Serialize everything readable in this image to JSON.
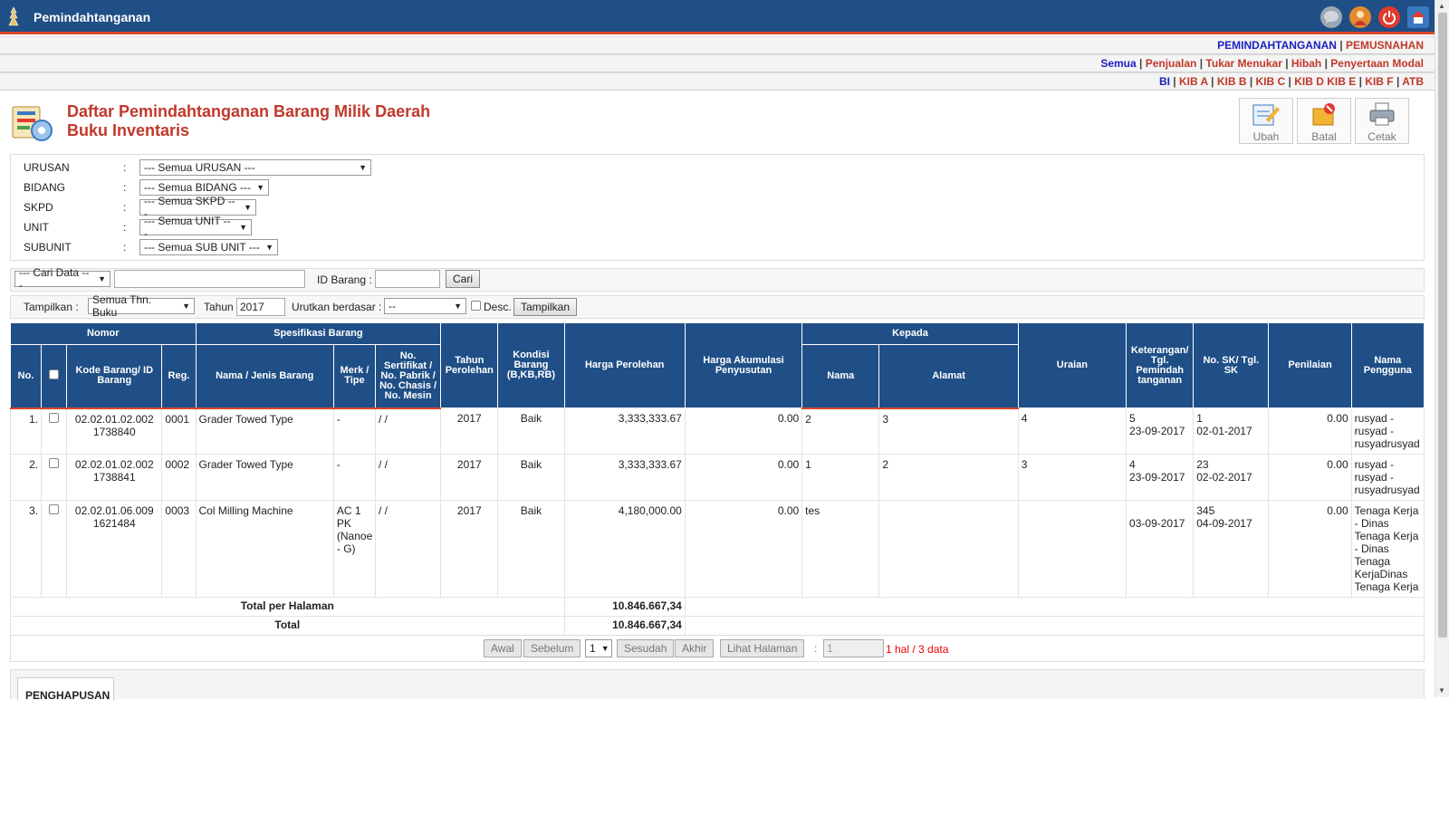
{
  "app": {
    "title": "Pemindahtanganan"
  },
  "header_icons": [
    "chat-icon",
    "user-icon",
    "power-icon",
    "home-icon"
  ],
  "nav1": [
    "PEMINDAHTANGANAN",
    "PEMUSNAHAN"
  ],
  "nav2": [
    "Semua",
    "Penjualan",
    "Tukar Menukar",
    "Hibah",
    "Penyertaan Modal"
  ],
  "nav3": [
    "BI",
    "KIB A",
    "KIB B",
    "KIB C",
    "KIB D",
    "KIB E",
    "KIB F",
    "ATB"
  ],
  "page": {
    "title_line1": "Daftar Pemindahtanganan Barang Milik Daerah",
    "title_line2": "Buku Inventaris"
  },
  "toolbar": {
    "edit": "Ubah",
    "cancel": "Batal",
    "print": "Cetak"
  },
  "filters": {
    "urusan_label": "URUSAN",
    "urusan_value": "--- Semua URUSAN ---",
    "bidang_label": "BIDANG",
    "bidang_value": "--- Semua BIDANG ---",
    "skpd_label": "SKPD",
    "skpd_value": "--- Semua SKPD ---",
    "unit_label": "UNIT",
    "unit_value": "--- Semua UNIT ---",
    "subunit_label": "SUBUNIT",
    "subunit_value": "--- Semua SUB UNIT ---"
  },
  "search": {
    "select_value": "--- Cari Data ---",
    "id_label": "ID Barang :",
    "button": "Cari"
  },
  "display": {
    "label": "Tampilkan :",
    "year_select": "Semua Thn. Buku",
    "tahun_label": "Tahun",
    "tahun_value": "2017",
    "sort_label": "Urutkan berdasar :",
    "sort_value": "--",
    "desc_label": "Desc.",
    "button": "Tampilkan"
  },
  "table": {
    "group_nomor": "Nomor",
    "group_spec": "Spesifikasi Barang",
    "group_kepada": "Kepada",
    "h_no": "No.",
    "h_kode": "Kode Barang/ ID Barang",
    "h_reg": "Reg.",
    "h_nama": "Nama / Jenis Barang",
    "h_merk": "Merk / Tipe",
    "h_sert": "No. Sertifikat / No. Pabrik / No. Chasis / No. Mesin",
    "h_tahun": "Tahun Perolehan",
    "h_kondisi": "Kondisi Barang (B,KB,RB)",
    "h_harga": "Harga Perolehan",
    "h_akum": "Harga Akumulasi Penyusutan",
    "h_kep_nama": "Nama",
    "h_kep_alamat": "Alamat",
    "h_uraian": "Uraian",
    "h_ket": "Keterangan/ Tgl. Pemindah tanganan",
    "h_sk": "No. SK/ Tgl. SK",
    "h_penilaian": "Penilaian",
    "h_pengguna": "Nama Pengguna",
    "rows": [
      {
        "no": "1.",
        "kode": "02.02.01.02.002\n1738840",
        "reg": "0001",
        "nama": "Grader Towed Type",
        "merk": "-",
        "sert": "/ /",
        "tahun": "2017",
        "kondisi": "Baik",
        "harga": "3,333,333.67",
        "akum": "0.00",
        "kep_nama": "2",
        "kep_alamat": "3",
        "uraian": "4",
        "ket": "5\n23-09-2017",
        "sk": "1\n02-01-2017",
        "penilaian": "0.00",
        "pengguna": "rusyad - rusyad - rusyadrusyad"
      },
      {
        "no": "2.",
        "kode": "02.02.01.02.002\n1738841",
        "reg": "0002",
        "nama": "Grader Towed Type",
        "merk": "-",
        "sert": "/ /",
        "tahun": "2017",
        "kondisi": "Baik",
        "harga": "3,333,333.67",
        "akum": "0.00",
        "kep_nama": "1",
        "kep_alamat": "2",
        "uraian": "3",
        "ket": "4\n23-09-2017",
        "sk": "23\n02-02-2017",
        "penilaian": "0.00",
        "pengguna": "rusyad - rusyad - rusyadrusyad"
      },
      {
        "no": "3.",
        "kode": "02.02.01.06.009\n1621484",
        "reg": "0003",
        "nama": "Col Milling Machine",
        "merk": "AC 1 PK (Nanoe - G)",
        "sert": "/ /",
        "tahun": "2017",
        "kondisi": "Baik",
        "harga": "4,180,000.00",
        "akum": "0.00",
        "kep_nama": "tes",
        "kep_alamat": "",
        "uraian": "",
        "ket": "\n03-09-2017",
        "sk": "345\n04-09-2017",
        "penilaian": "0.00",
        "pengguna": "Tenaga Kerja - Dinas Tenaga Kerja - Dinas Tenaga KerjaDinas Tenaga Kerja"
      }
    ],
    "total_page_label": "Total per Halaman",
    "total_page_value": "10.846.667,34",
    "total_label": "Total",
    "total_value": "10.846.667,34"
  },
  "pager": {
    "first": "Awal",
    "prev": "Sebelum",
    "page": "1",
    "next": "Sesudah",
    "last": "Akhir",
    "view": "Lihat Halaman",
    "colon": ":",
    "input": "1",
    "info": "1 hal  /  3 data"
  },
  "bottom_tab": "PENGHAPUSAN",
  "colors": {
    "header": "#1f4f86",
    "accent": "#d9452a",
    "link": "#c0392b",
    "active_link": "#1a22c0"
  }
}
